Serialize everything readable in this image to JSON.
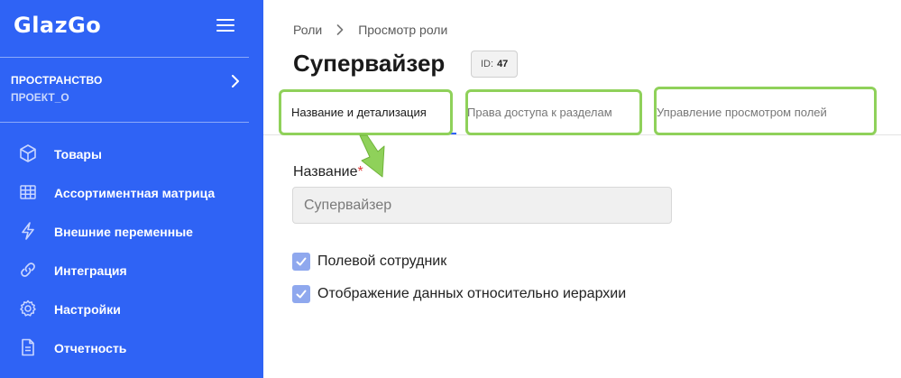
{
  "sidebar": {
    "logo": "GlazGo",
    "space": {
      "title": "ПРОСТРАНСТВО",
      "value": "ПРОЕКТ_О"
    },
    "items": [
      {
        "label": "Товары",
        "icon": "cube-icon"
      },
      {
        "label": "Ассортиментная матрица",
        "icon": "grid-icon"
      },
      {
        "label": "Внешние переменные",
        "icon": "lightning-icon"
      },
      {
        "label": "Интеграция",
        "icon": "link-icon"
      },
      {
        "label": "Настройки",
        "icon": "gear-icon"
      },
      {
        "label": "Отчетность",
        "icon": "document-icon"
      }
    ]
  },
  "breadcrumb": {
    "root": "Роли",
    "current": "Просмотр роли"
  },
  "page": {
    "title": "Супервайзер",
    "id_label": "ID:",
    "id_value": "47"
  },
  "tabs": [
    {
      "label": "Название и детализация",
      "active": true
    },
    {
      "label": "Права доступа к разделам",
      "active": false
    },
    {
      "label": "Управление просмотром полей",
      "active": false
    }
  ],
  "form": {
    "name_label": "Название",
    "required_mark": "*",
    "name_value": "Супервайзер",
    "checkboxes": [
      {
        "label": "Полевой сотрудник",
        "checked": true
      },
      {
        "label": "Отображение данных относительно иерархии",
        "checked": true
      }
    ]
  },
  "colors": {
    "sidebar": "#2f63f5",
    "highlight": "#8fd15a",
    "checkbox": "#8fa8ee"
  }
}
